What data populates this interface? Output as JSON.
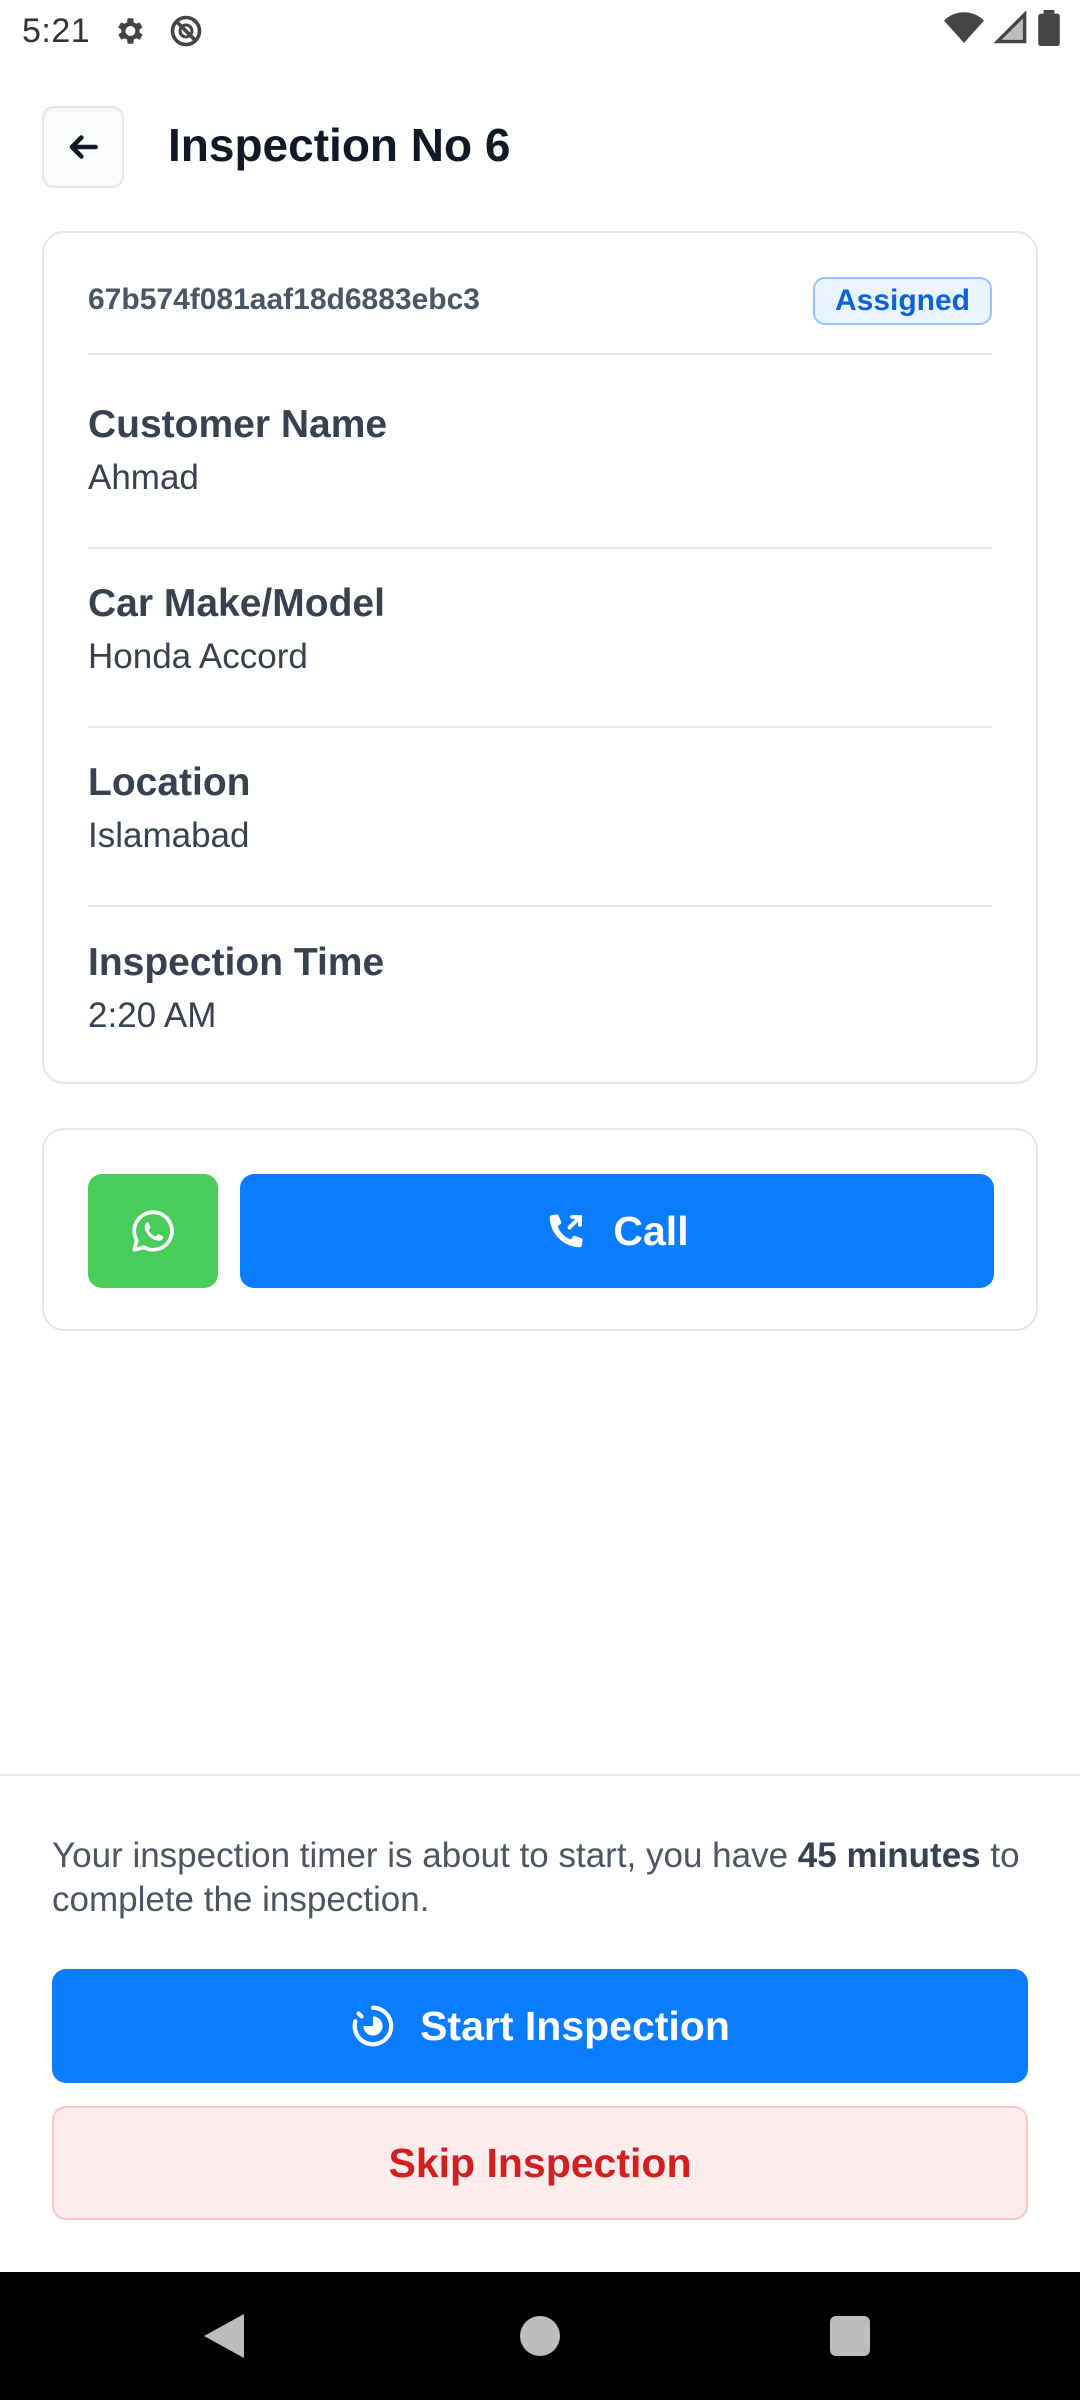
{
  "status_bar": {
    "time": "5:21",
    "icons_left": [
      "gear-icon",
      "do-not-disturb-icon"
    ],
    "icons_right": [
      "wifi-icon",
      "signal-icon",
      "battery-icon"
    ]
  },
  "header": {
    "title": "Inspection No 6",
    "back_icon": "arrow-left-icon"
  },
  "inspection": {
    "id": "67b574f081aaf18d6883ebc3",
    "status": "Assigned",
    "fields": [
      {
        "label": "Customer Name",
        "value": "Ahmad"
      },
      {
        "label": "Car Make/Model",
        "value": "Honda Accord"
      },
      {
        "label": "Location",
        "value": "Islamabad"
      },
      {
        "label": "Inspection Time",
        "value": "2:20 AM"
      }
    ]
  },
  "contact": {
    "whatsapp_icon": "whatsapp-icon",
    "call_label": "Call",
    "call_icon": "phone-outgoing-icon"
  },
  "timer": {
    "text_before": "Your inspection timer is about to start, you have ",
    "duration": "45 minutes",
    "text_after": " to complete the inspection."
  },
  "actions": {
    "start_label": "Start Inspection",
    "start_icon": "timer-icon",
    "skip_label": "Skip Inspection"
  },
  "colors": {
    "primary": "#0a7cff",
    "whatsapp": "#48cc5a",
    "danger_text": "#d21f1f",
    "danger_bg": "#fdecec",
    "badge_text": "#0b63d6",
    "badge_bg": "#eaf4ff"
  }
}
